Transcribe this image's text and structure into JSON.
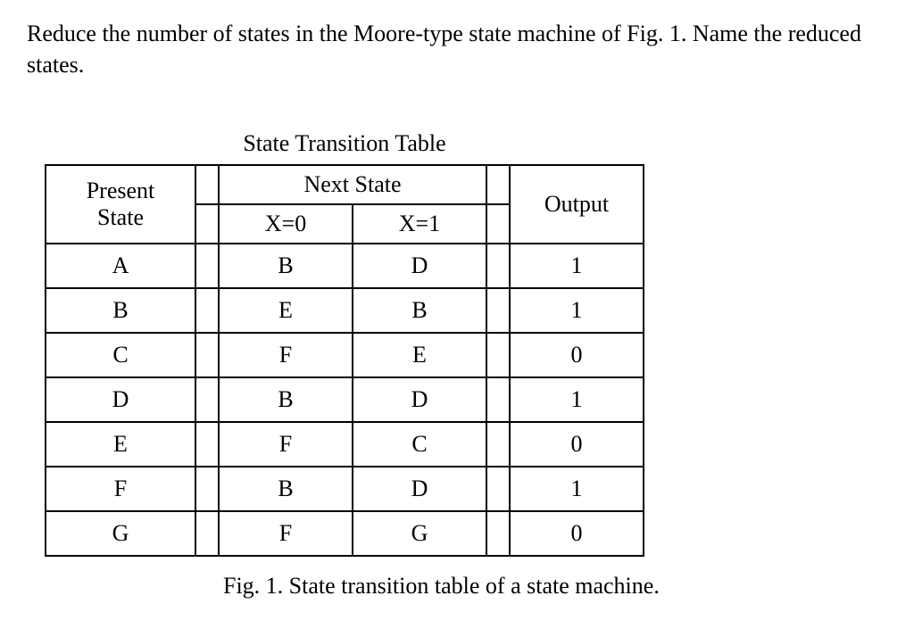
{
  "prompt": "Reduce the number of states in the Moore-type state machine of Fig. 1.  Name the reduced states.",
  "table": {
    "title": "State Transition Table",
    "headers": {
      "present": "Present State",
      "present_line1": "Present",
      "present_line2": "State",
      "next": "Next State",
      "x0": "X=0",
      "x1": "X=1",
      "output": "Output"
    },
    "rows": [
      {
        "present": "A",
        "x0": "B",
        "x1": "D",
        "out": "1"
      },
      {
        "present": "B",
        "x0": "E",
        "x1": "B",
        "out": "1"
      },
      {
        "present": "C",
        "x0": "F",
        "x1": "E",
        "out": "0"
      },
      {
        "present": "D",
        "x0": "B",
        "x1": "D",
        "out": "1"
      },
      {
        "present": "E",
        "x0": "F",
        "x1": "C",
        "out": "0"
      },
      {
        "present": "F",
        "x0": "B",
        "x1": "D",
        "out": "1"
      },
      {
        "present": "G",
        "x0": "F",
        "x1": "G",
        "out": "0"
      }
    ]
  },
  "caption": "Fig. 1.  State transition table of a state machine.",
  "chart_data": {
    "type": "table",
    "title": "State Transition Table",
    "columns": [
      "Present State",
      "Next State X=0",
      "Next State X=1",
      "Output"
    ],
    "rows": [
      [
        "A",
        "B",
        "D",
        1
      ],
      [
        "B",
        "E",
        "B",
        1
      ],
      [
        "C",
        "F",
        "E",
        0
      ],
      [
        "D",
        "B",
        "D",
        1
      ],
      [
        "E",
        "F",
        "C",
        0
      ],
      [
        "F",
        "B",
        "D",
        1
      ],
      [
        "G",
        "F",
        "G",
        0
      ]
    ]
  }
}
